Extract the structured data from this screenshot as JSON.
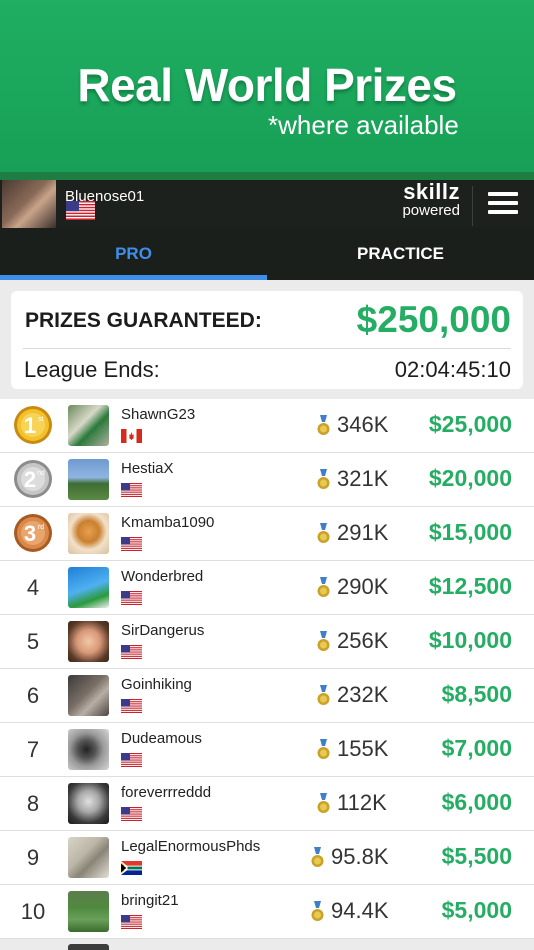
{
  "banner": {
    "title": "Real World Prizes",
    "subtitle": "*where available"
  },
  "user": {
    "name": "Bluenose01",
    "flag": "us"
  },
  "branding": {
    "line1": "skillz",
    "line2": "powered"
  },
  "tabs": [
    {
      "label": "PRO",
      "active": true
    },
    {
      "label": "PRACTICE",
      "active": false
    }
  ],
  "prizes": {
    "label": "PRIZES GUARANTEED:",
    "amount": "$250,000"
  },
  "league": {
    "label": "League Ends:",
    "time": "02:04:45:10"
  },
  "leaderboard": [
    {
      "rank": "1",
      "medal": "gold",
      "medal_suffix": "st",
      "name": "ShawnG23",
      "flag": "ca",
      "score": "346K",
      "prize": "$25,000"
    },
    {
      "rank": "2",
      "medal": "silver",
      "medal_suffix": "nd",
      "name": "HestiaX",
      "flag": "us",
      "score": "321K",
      "prize": "$20,000"
    },
    {
      "rank": "3",
      "medal": "bronze",
      "medal_suffix": "rd",
      "name": "Kmamba1090",
      "flag": "us",
      "score": "291K",
      "prize": "$15,000"
    },
    {
      "rank": "4",
      "name": "Wonderbred",
      "flag": "us",
      "score": "290K",
      "prize": "$12,500"
    },
    {
      "rank": "5",
      "name": "SirDangerus",
      "flag": "us",
      "score": "256K",
      "prize": "$10,000"
    },
    {
      "rank": "6",
      "name": "Goinhiking",
      "flag": "us",
      "score": "232K",
      "prize": "$8,500"
    },
    {
      "rank": "7",
      "name": "Dudeamous",
      "flag": "us",
      "score": "155K",
      "prize": "$7,000"
    },
    {
      "rank": "8",
      "name": "foreverrreddd",
      "flag": "us",
      "score": "112K",
      "prize": "$6,000"
    },
    {
      "rank": "9",
      "name": "LegalEnormousPhds",
      "flag": "za",
      "score": "95.8K",
      "prize": "$5,500"
    },
    {
      "rank": "10",
      "name": "bringit21",
      "flag": "us",
      "score": "94.4K",
      "prize": "$5,000"
    }
  ],
  "colors": {
    "accent_green": "#25ad63",
    "active_tab": "#3f8fe8",
    "banner_green": "#1fae62",
    "topbar": "#1c211d"
  },
  "icons": {
    "menu": "hamburger-menu-icon",
    "score": "medal-score-icon"
  }
}
